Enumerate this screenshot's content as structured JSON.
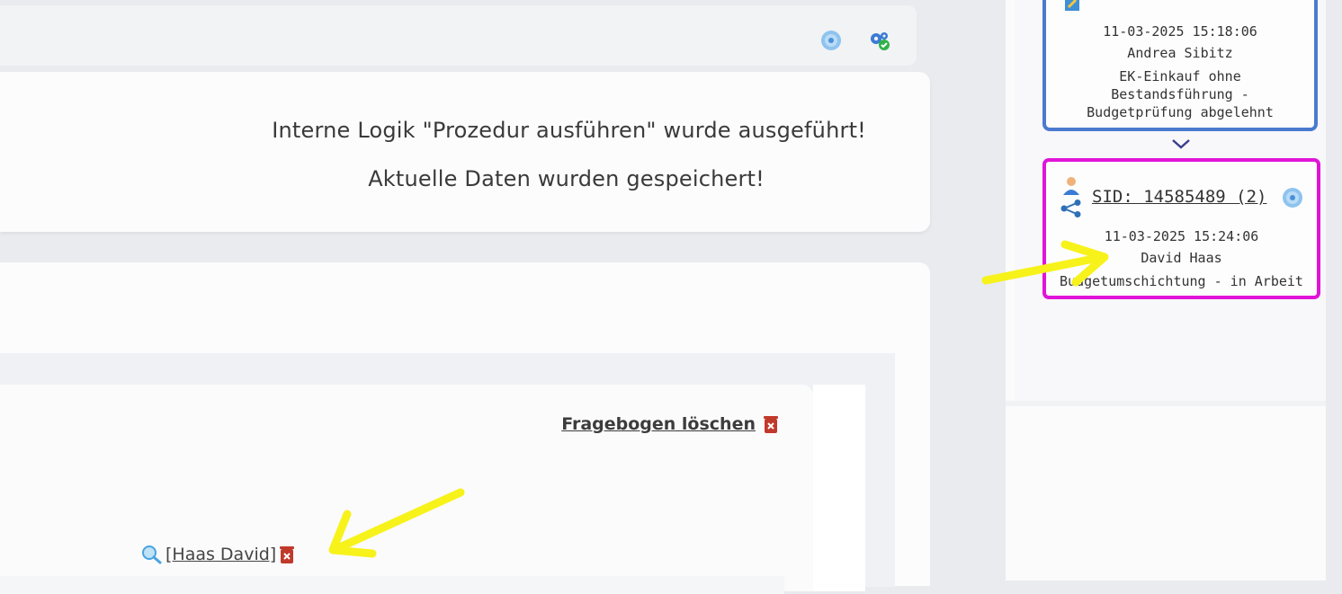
{
  "toolbar": {
    "icons": [
      "disc-icon",
      "gears-icon"
    ]
  },
  "messages": {
    "line1": "Interne Logik \"Prozedur ausführen\" wurde ausgeführt!",
    "line2": "Aktuelle Daten wurden gespeichert!"
  },
  "form": {
    "delete_label": "Fragebogen löschen ",
    "person_label": " [Haas David]"
  },
  "timeline": {
    "previous": {
      "timestamp": "11-03-2025 15:18:06",
      "user": "Andrea Sibitz",
      "status_lines": [
        "EK-Einkauf ohne",
        "Bestandsführung -",
        "Budgetprüfung abgelehnt"
      ]
    },
    "current": {
      "sid": "SID: 14585489 (2)",
      "timestamp": "11-03-2025 15:24:06",
      "user": "David Haas",
      "status": "Budgetumschichtung - in Arbeit"
    }
  },
  "colors": {
    "highlight_current": "#e014d9",
    "highlight_previous": "#4a7bcf",
    "annotation_arrow": "#f7f21a",
    "delete_icon": "#c0392b"
  }
}
